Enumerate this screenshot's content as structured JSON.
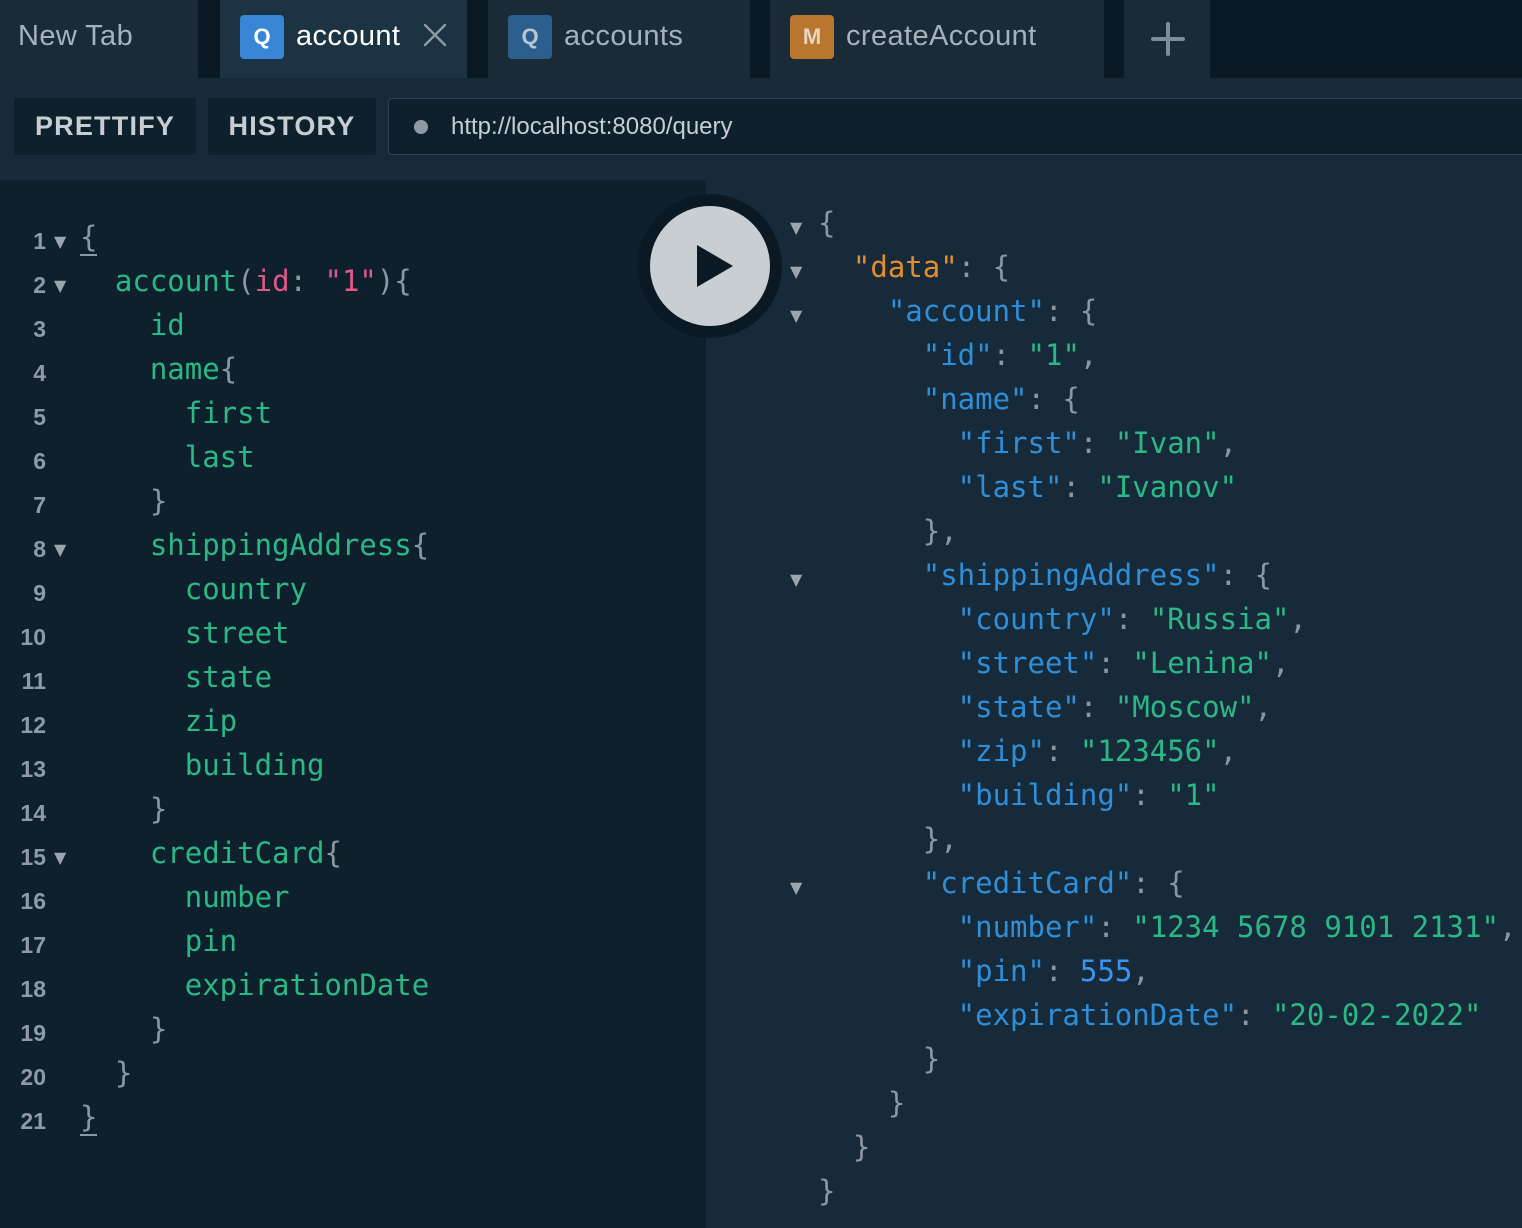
{
  "tabs": [
    {
      "label": "New Tab",
      "badge": "",
      "active": false
    },
    {
      "label": "account",
      "badge": "Q",
      "badge_color": "#3a86d6",
      "active": true
    },
    {
      "label": "accounts",
      "badge": "Q",
      "badge_color": "#2c5f8e",
      "active": false
    },
    {
      "label": "createAccount",
      "badge": "M",
      "badge_color": "#b8762f",
      "active": false
    }
  ],
  "toolbar": {
    "prettify_label": "PRETTIFY",
    "history_label": "HISTORY",
    "endpoint_url": "http://localhost:8080/query"
  },
  "colors": {
    "field": "#2bb886",
    "argument": "#e0588a",
    "json_key": "#2e8fd8",
    "json_string": "#2bb886",
    "json_number": "#3a95f0",
    "data_key": "#e48d2f",
    "punctuation": "#8b98a3"
  },
  "editor": {
    "lines": [
      {
        "n": "1",
        "fold": true,
        "tokens": [
          [
            "p",
            "{"
          ]
        ]
      },
      {
        "n": "2",
        "fold": true,
        "tokens": [
          [
            "f",
            "  account"
          ],
          [
            "p",
            "("
          ],
          [
            "a",
            "id"
          ],
          [
            "p",
            ": "
          ],
          [
            "s",
            "\"1\""
          ],
          [
            "p",
            "){"
          ]
        ]
      },
      {
        "n": "3",
        "tokens": [
          [
            "f",
            "    id"
          ]
        ]
      },
      {
        "n": "4",
        "tokens": [
          [
            "f",
            "    name"
          ],
          [
            "p",
            "{"
          ]
        ]
      },
      {
        "n": "5",
        "tokens": [
          [
            "f",
            "      first"
          ]
        ]
      },
      {
        "n": "6",
        "tokens": [
          [
            "f",
            "      last"
          ]
        ]
      },
      {
        "n": "7",
        "tokens": [
          [
            "p",
            "    }"
          ]
        ]
      },
      {
        "n": "8",
        "fold": true,
        "tokens": [
          [
            "f",
            "    shippingAddress"
          ],
          [
            "p",
            "{"
          ]
        ]
      },
      {
        "n": "9",
        "tokens": [
          [
            "f",
            "      country"
          ]
        ]
      },
      {
        "n": "10",
        "tokens": [
          [
            "f",
            "      street"
          ]
        ]
      },
      {
        "n": "11",
        "tokens": [
          [
            "f",
            "      state"
          ]
        ]
      },
      {
        "n": "12",
        "tokens": [
          [
            "f",
            "      zip"
          ]
        ]
      },
      {
        "n": "13",
        "tokens": [
          [
            "f",
            "      building"
          ]
        ]
      },
      {
        "n": "14",
        "tokens": [
          [
            "p",
            "    }"
          ]
        ]
      },
      {
        "n": "15",
        "fold": true,
        "tokens": [
          [
            "f",
            "    creditCard"
          ],
          [
            "p",
            "{"
          ]
        ]
      },
      {
        "n": "16",
        "tokens": [
          [
            "f",
            "      number"
          ]
        ]
      },
      {
        "n": "17",
        "tokens": [
          [
            "f",
            "      pin"
          ]
        ]
      },
      {
        "n": "18",
        "tokens": [
          [
            "f",
            "      expirationDate"
          ]
        ]
      },
      {
        "n": "19",
        "tokens": [
          [
            "p",
            "    }"
          ]
        ]
      },
      {
        "n": "20",
        "tokens": [
          [
            "p",
            "  }"
          ]
        ]
      },
      {
        "n": "21",
        "tokens": [
          [
            "p",
            "}"
          ]
        ]
      }
    ]
  },
  "result": {
    "lines": [
      {
        "fold": true,
        "tokens": [
          [
            "p",
            "{"
          ]
        ]
      },
      {
        "fold": true,
        "tokens": [
          [
            "d",
            "  \"data\""
          ],
          [
            "p",
            ": {"
          ]
        ]
      },
      {
        "fold": true,
        "tokens": [
          [
            "k",
            "    \"account\""
          ],
          [
            "p",
            ": {"
          ]
        ]
      },
      {
        "tokens": [
          [
            "k",
            "      \"id\""
          ],
          [
            "p",
            ": "
          ],
          [
            "v",
            "\"1\""
          ],
          [
            "p",
            ","
          ]
        ]
      },
      {
        "tokens": [
          [
            "k",
            "      \"name\""
          ],
          [
            "p",
            ": {"
          ]
        ]
      },
      {
        "tokens": [
          [
            "k",
            "        \"first\""
          ],
          [
            "p",
            ": "
          ],
          [
            "v",
            "\"Ivan\""
          ],
          [
            "p",
            ","
          ]
        ]
      },
      {
        "tokens": [
          [
            "k",
            "        \"last\""
          ],
          [
            "p",
            ": "
          ],
          [
            "v",
            "\"Ivanov\""
          ]
        ]
      },
      {
        "tokens": [
          [
            "p",
            "      },"
          ]
        ]
      },
      {
        "fold": true,
        "tokens": [
          [
            "k",
            "      \"shippingAddress\""
          ],
          [
            "p",
            ": {"
          ]
        ]
      },
      {
        "tokens": [
          [
            "k",
            "        \"country\""
          ],
          [
            "p",
            ": "
          ],
          [
            "v",
            "\"Russia\""
          ],
          [
            "p",
            ","
          ]
        ]
      },
      {
        "tokens": [
          [
            "k",
            "        \"street\""
          ],
          [
            "p",
            ": "
          ],
          [
            "v",
            "\"Lenina\""
          ],
          [
            "p",
            ","
          ]
        ]
      },
      {
        "tokens": [
          [
            "k",
            "        \"state\""
          ],
          [
            "p",
            ": "
          ],
          [
            "v",
            "\"Moscow\""
          ],
          [
            "p",
            ","
          ]
        ]
      },
      {
        "tokens": [
          [
            "k",
            "        \"zip\""
          ],
          [
            "p",
            ": "
          ],
          [
            "v",
            "\"123456\""
          ],
          [
            "p",
            ","
          ]
        ]
      },
      {
        "tokens": [
          [
            "k",
            "        \"building\""
          ],
          [
            "p",
            ": "
          ],
          [
            "v",
            "\"1\""
          ]
        ]
      },
      {
        "tokens": [
          [
            "p",
            "      },"
          ]
        ]
      },
      {
        "fold": true,
        "tokens": [
          [
            "k",
            "      \"creditCard\""
          ],
          [
            "p",
            ": {"
          ]
        ]
      },
      {
        "tokens": [
          [
            "k",
            "        \"number\""
          ],
          [
            "p",
            ": "
          ],
          [
            "v",
            "\"1234 5678 9101 2131\""
          ],
          [
            "p",
            ","
          ]
        ]
      },
      {
        "tokens": [
          [
            "k",
            "        \"pin\""
          ],
          [
            "p",
            ": "
          ],
          [
            "n",
            "555"
          ],
          [
            "p",
            ","
          ]
        ]
      },
      {
        "tokens": [
          [
            "k",
            "        \"expirationDate\""
          ],
          [
            "p",
            ": "
          ],
          [
            "v",
            "\"20-02-2022\""
          ]
        ]
      },
      {
        "tokens": [
          [
            "p",
            "      }"
          ]
        ]
      },
      {
        "tokens": [
          [
            "p",
            "    }"
          ]
        ]
      },
      {
        "tokens": [
          [
            "p",
            "  }"
          ]
        ]
      },
      {
        "tokens": [
          [
            "p",
            "}"
          ]
        ]
      }
    ]
  }
}
